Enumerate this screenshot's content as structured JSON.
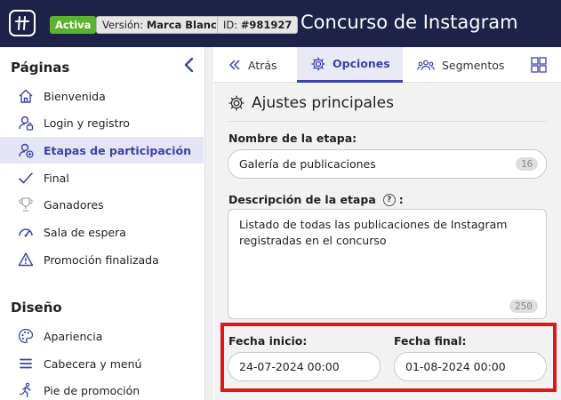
{
  "header": {
    "status_badge": "Activa",
    "version_label": "Versión:",
    "version_value": "Marca Blanca",
    "id_label": "ID:",
    "id_value": "#981927",
    "title": "Concurso de Instagram"
  },
  "sidebar": {
    "pages_title": "Páginas",
    "design_title": "Diseño",
    "pages": [
      {
        "label": "Bienvenida",
        "icon": "home-icon"
      },
      {
        "label": "Login y registro",
        "icon": "user-lock-icon"
      },
      {
        "label": "Etapas de participación",
        "icon": "user-add-icon"
      },
      {
        "label": "Final",
        "icon": "check-icon"
      },
      {
        "label": "Ganadores",
        "icon": "trophy-icon"
      },
      {
        "label": "Sala de espera",
        "icon": "gauge-icon"
      },
      {
        "label": "Promoción finalizada",
        "icon": "warning-icon"
      }
    ],
    "design": [
      {
        "label": "Apariencia",
        "icon": "palette-icon"
      },
      {
        "label": "Cabecera y menú",
        "icon": "menu-icon"
      },
      {
        "label": "Pie de promoción",
        "icon": "runner-icon"
      }
    ]
  },
  "tabs": {
    "back": "Atrás",
    "options": "Opciones",
    "segments": "Segmentos"
  },
  "form": {
    "section_title": "Ajustes principales",
    "stage_name_label": "Nombre de la etapa:",
    "stage_name_value": "Galería de publicaciones",
    "stage_name_counter": "16",
    "description_label": "Descripción de la etapa",
    "description_suffix": ":",
    "description_value": "Listado de todas las publicaciones de Instagram registradas en el concurso",
    "description_counter": "250",
    "start_label": "Fecha inicio:",
    "start_value": "24-07-2024 00:00",
    "end_label": "Fecha final:",
    "end_value": "01-08-2024 00:00"
  },
  "colors": {
    "header_bg": "#1d2249",
    "accent": "#3c42a8",
    "active_badge": "#5bb230",
    "highlight": "#e0161b"
  }
}
